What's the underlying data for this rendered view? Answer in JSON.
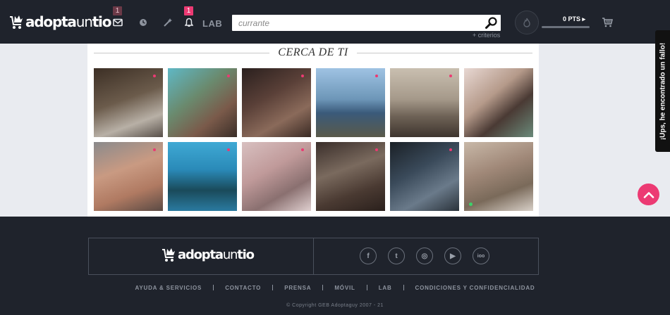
{
  "header": {
    "logo_bold": "adopta",
    "logo_light": "un",
    "logo_end": "tio",
    "messages_badge": "1",
    "notifications_badge": "1",
    "lab_label": "LAB",
    "search_placeholder": "currante",
    "criteria_link": "+ criterios",
    "points_label": "0 PTS"
  },
  "main": {
    "section_title": "CERCA DE TI",
    "profiles": [
      {
        "row": 0,
        "col": 0,
        "bg": "linear-gradient(160deg,#3c2f25 0%,#6b5b4b 45%,#b8b0a6 75%,#58504a 100%)",
        "new": true
      },
      {
        "row": 0,
        "col": 1,
        "bg": "linear-gradient(140deg,#5fb8c5 0%,#6a8a6e 40%,#7a5a4a 70%,#3a2e28 100%)",
        "new": true
      },
      {
        "row": 0,
        "col": 2,
        "bg": "linear-gradient(150deg,#2a201e 0%,#5a4038 40%,#8a6a5a 70%,#3a2a24 100%)",
        "new": true
      },
      {
        "row": 0,
        "col": 3,
        "bg": "linear-gradient(180deg,#9fc3e3 0%,#6d96b8 45%,#3a5a7a 65%,#5a5a4a 100%)",
        "new": true
      },
      {
        "row": 0,
        "col": 4,
        "bg": "linear-gradient(180deg,#c9bfb0 0%,#a5998a 45%,#6e6256 70%,#3e352e 100%)",
        "new": true
      },
      {
        "row": 0,
        "col": 5,
        "bg": "linear-gradient(140deg,#e8d8d3 0%,#b59a8a 40%,#4a3a34 65%,#6a8a7a 100%)",
        "new": false
      },
      {
        "row": 1,
        "col": 0,
        "bg": "linear-gradient(160deg,#8a8a8c 0%,#c99a82 40%,#b07a62 70%,#5a4a44 100%)",
        "new": true
      },
      {
        "row": 1,
        "col": 1,
        "bg": "linear-gradient(180deg,#3fa9d4 0%,#2a8ab8 40%,#1a4a5a 70%,#2a7aa0 100%)",
        "new": true
      },
      {
        "row": 1,
        "col": 2,
        "bg": "linear-gradient(150deg,#d8c0c0 0%,#c09a9a 40%,#8a7070 70%,#e0d0d0 100%)",
        "new": true
      },
      {
        "row": 1,
        "col": 3,
        "bg": "linear-gradient(160deg,#3a2e2a 0%,#7a6a5e 40%,#4a3a32 70%,#2a201c 100%)",
        "new": true
      },
      {
        "row": 1,
        "col": 4,
        "bg": "linear-gradient(150deg,#1a2026 0%,#3a4a5a 40%,#6a7a8a 70%,#2a323a 100%)",
        "new": true
      },
      {
        "row": 1,
        "col": 5,
        "bg": "linear-gradient(160deg,#c8b8a8 0%,#a08878 40%,#7a6a5a 70%,#d8d0c8 100%)",
        "new": false,
        "online": true
      }
    ]
  },
  "feedback_label": "¡Ups, he encontrado un fallo!",
  "footer": {
    "social": [
      {
        "name": "facebook",
        "glyph": "f"
      },
      {
        "name": "twitter",
        "glyph": "t"
      },
      {
        "name": "instagram",
        "glyph": "◎"
      },
      {
        "name": "youtube",
        "glyph": "▶"
      },
      {
        "name": "ioo",
        "glyph": "ioo"
      }
    ],
    "links": [
      "AYUDA & SERVICIOS",
      "CONTACTO",
      "PRENSA",
      "MÓVIL",
      "LAB",
      "CONDICIONES Y CONFIDENCIALIDAD"
    ],
    "copyright": "© Copyright GEB Adoptaguy 2007 - 21"
  },
  "colors": {
    "accent": "#ec3a73",
    "header_bg": "#1f232c",
    "page_bg": "#e9ebf0"
  }
}
